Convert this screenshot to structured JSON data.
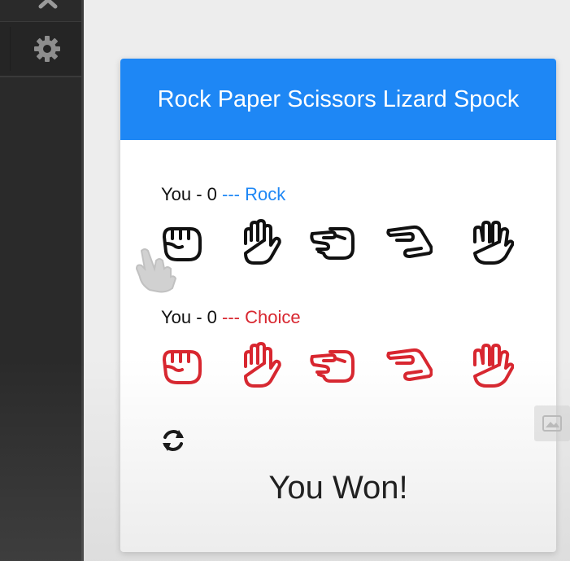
{
  "game": {
    "title": "Rock Paper Scissors Lizard Spock",
    "player_line": {
      "label": "You - 0",
      "dash": " --- ",
      "pick": "Rock"
    },
    "opponent_line": {
      "label": "You - 0",
      "dash": " --- ",
      "pick": "Choice"
    },
    "hands": [
      "rock",
      "paper",
      "scissors",
      "lizard",
      "spock"
    ],
    "result": "You Won!"
  },
  "icons": {
    "sidebar": [
      "close-icon",
      "gear-icon"
    ],
    "player_hands": [
      "rock-icon",
      "paper-icon",
      "scissors-icon",
      "lizard-icon",
      "spock-icon"
    ],
    "reset": "refresh-icon"
  },
  "colors": {
    "header": "#1e87f5",
    "player_icons": "#111111",
    "opponent_icons": "#d8262f"
  }
}
